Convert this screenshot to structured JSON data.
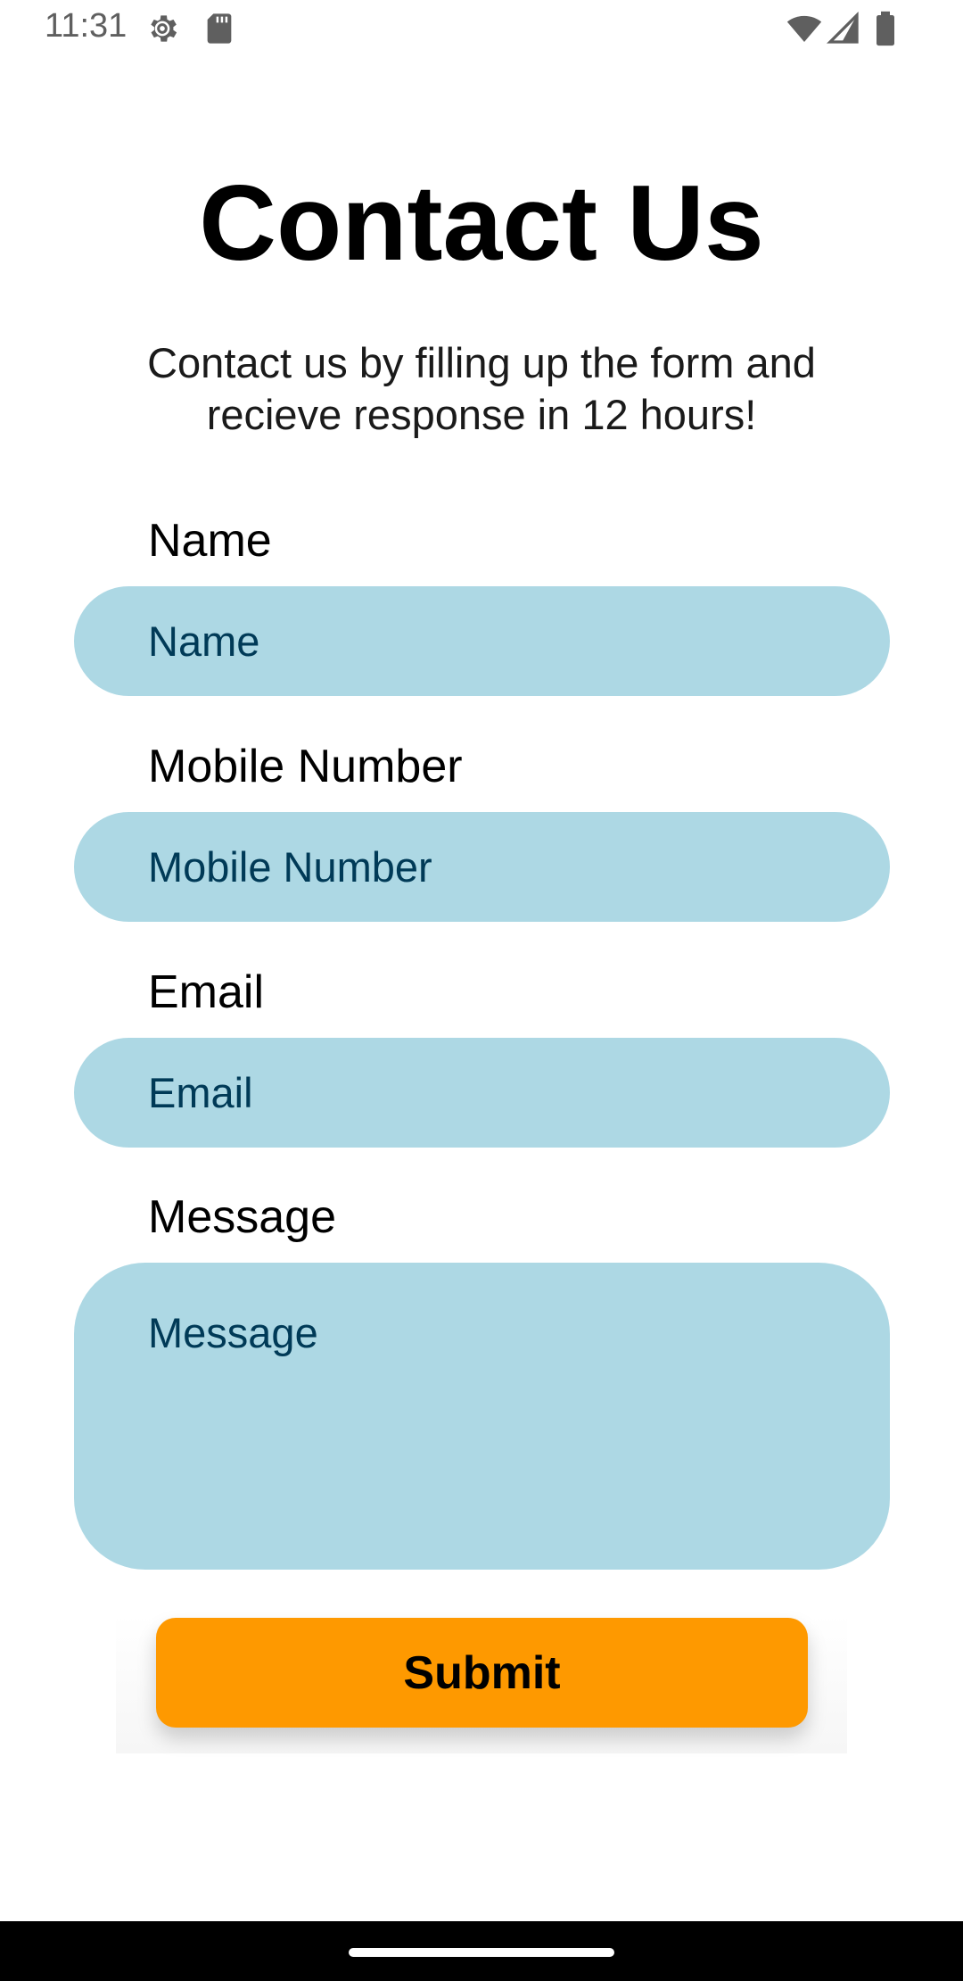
{
  "status_bar": {
    "time": "11:31",
    "icons": [
      "gear-icon",
      "sd-card-icon",
      "wifi-icon",
      "signal-icon",
      "battery-icon"
    ]
  },
  "page": {
    "title": "Contact Us",
    "subtitle": "Contact us by filling up the form and recieve response in 12 hours!"
  },
  "form": {
    "name": {
      "label": "Name",
      "placeholder": "Name"
    },
    "mobile": {
      "label": "Mobile Number",
      "placeholder": "Mobile Number"
    },
    "email": {
      "label": "Email",
      "placeholder": "Email"
    },
    "message": {
      "label": "Message",
      "placeholder": "Message"
    },
    "submit_label": "Submit"
  },
  "colors": {
    "field_background": "#add8e4",
    "field_text": "#003a57",
    "submit_background": "#fe9900",
    "nav_bar": "#000000"
  }
}
